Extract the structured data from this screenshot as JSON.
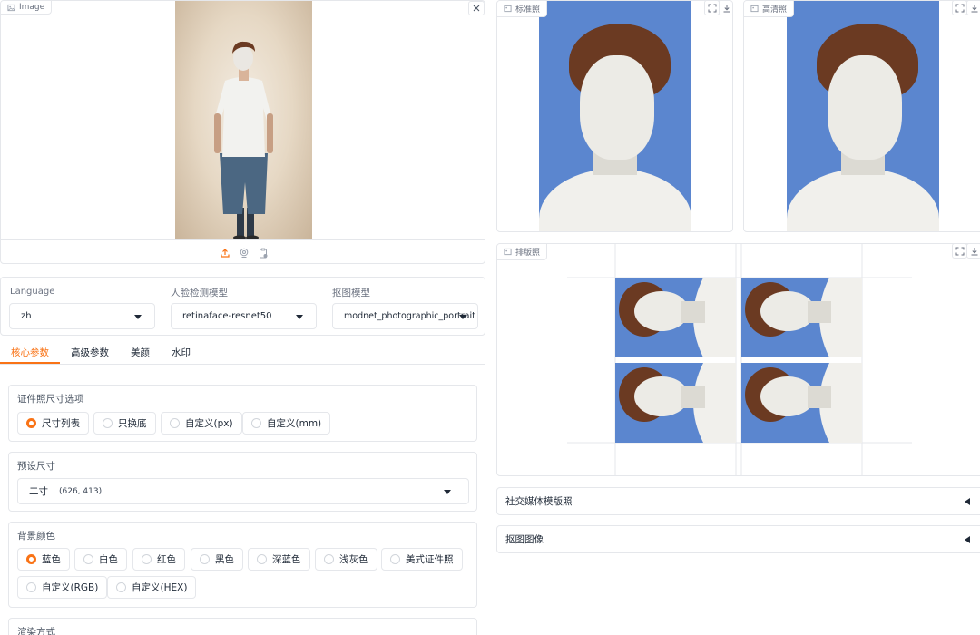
{
  "upload": {
    "label": "Image",
    "icons": [
      "upload-icon",
      "webcam-icon",
      "clipboard-icon"
    ]
  },
  "outputs": {
    "standard_label": "标准照",
    "hd_label": "高清照",
    "layout_label": "排版照"
  },
  "settings": {
    "language_label": "Language",
    "language_value": "zh",
    "face_model_label": "人脸检测模型",
    "face_model_value": "retinaface-resnet50",
    "matting_model_label": "抠图模型",
    "matting_model_value": "modnet_photographic_portrait"
  },
  "tabs": [
    {
      "label": "核心参数",
      "active": true
    },
    {
      "label": "高级参数",
      "active": false
    },
    {
      "label": "美颜",
      "active": false
    },
    {
      "label": "水印",
      "active": false
    }
  ],
  "size_options": {
    "title": "证件照尺寸选项",
    "options": [
      "尺寸列表",
      "只换底",
      "自定义(px)",
      "自定义(mm)"
    ],
    "selected": "尺寸列表"
  },
  "preset": {
    "title": "预设尺寸",
    "value": "二寸",
    "dims": "(626, 413)"
  },
  "background": {
    "title": "背景颜色",
    "options": [
      "蓝色",
      "白色",
      "红色",
      "黑色",
      "深蓝色",
      "浅灰色",
      "美式证件照",
      "自定义(RGB)",
      "自定义(HEX)"
    ],
    "selected": "蓝色",
    "selected_color": "#5b86cf"
  },
  "render": {
    "title": "渲染方式"
  },
  "accordions": [
    {
      "label": "社交媒体模版照"
    },
    {
      "label": "抠图图像"
    }
  ],
  "colors": {
    "accent": "#f97316",
    "photo_bg": "#5b86cf",
    "border": "#e5e7eb"
  }
}
